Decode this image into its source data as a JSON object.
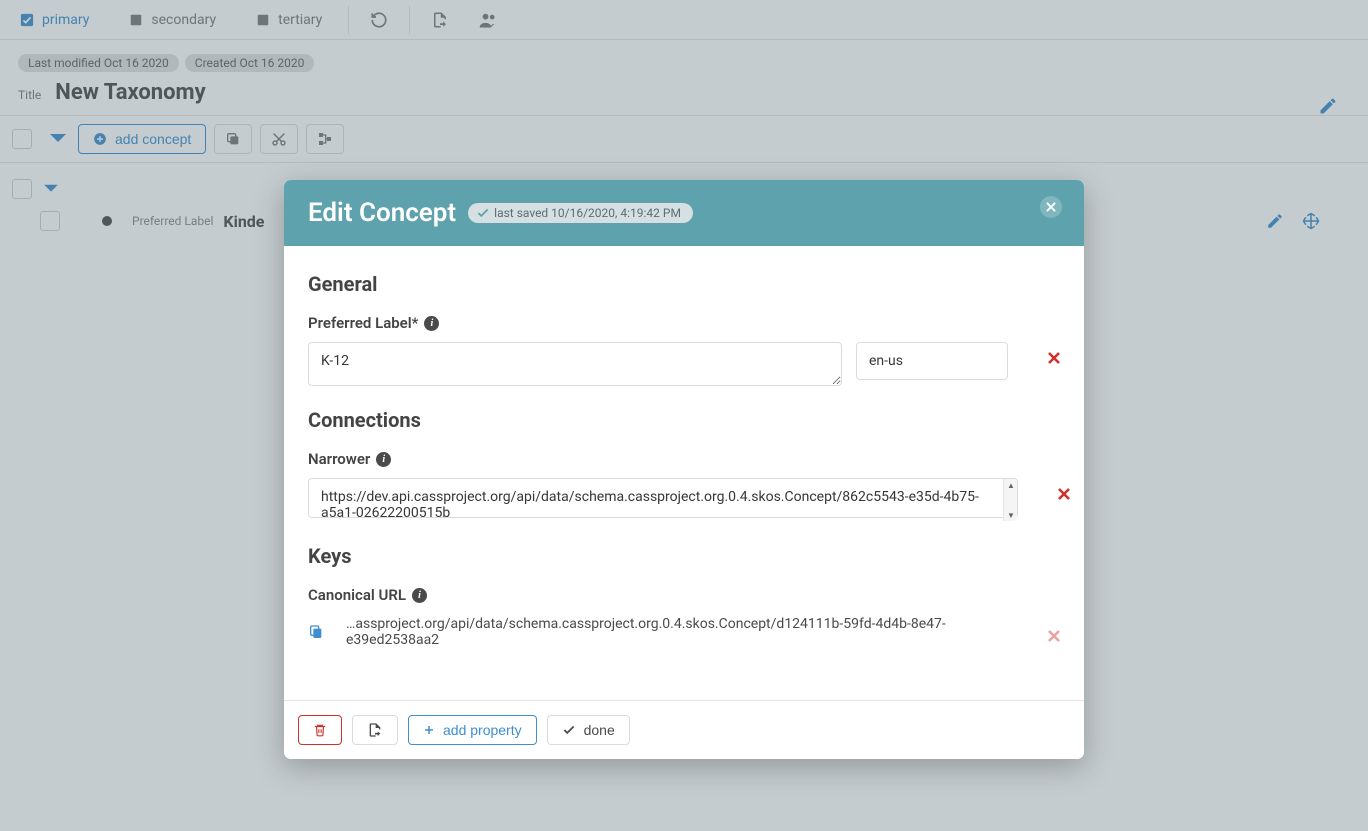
{
  "top": {
    "tabs": [
      {
        "label": "primary",
        "active": true
      },
      {
        "label": "secondary",
        "active": false
      },
      {
        "label": "tertiary",
        "active": false
      }
    ]
  },
  "taxonomy": {
    "last_modified": "Last modified Oct 16 2020",
    "created": "Created Oct 16 2020",
    "title_label": "Title",
    "title_value": "New Taxonomy"
  },
  "actionbar": {
    "add_concept": "add concept"
  },
  "tree": {
    "item_prefix": "Preferred Label",
    "item_title": "Kinde"
  },
  "modal": {
    "title": "Edit Concept",
    "saved": "last saved 10/16/2020, 4:19:42 PM",
    "sections": {
      "general": {
        "heading": "General",
        "preferred_label": "Preferred Label*",
        "value": "K-12",
        "lang": "en-us"
      },
      "connections": {
        "heading": "Connections",
        "narrower_label": "Narrower",
        "narrower_value": "https://dev.api.cassproject.org/api/data/schema.cassproject.org.0.4.skos.Concept/862c5543-e35d-4b75-a5a1-02622200515b"
      },
      "keys": {
        "heading": "Keys",
        "canonical_label": "Canonical URL",
        "canonical_value": "…assproject.org/api/data/schema.cassproject.org.0.4.skos.Concept/d124111b-59fd-4d4b-8e47-e39ed2538aa2"
      }
    },
    "footer": {
      "add_property": "add property",
      "done": "done"
    }
  }
}
